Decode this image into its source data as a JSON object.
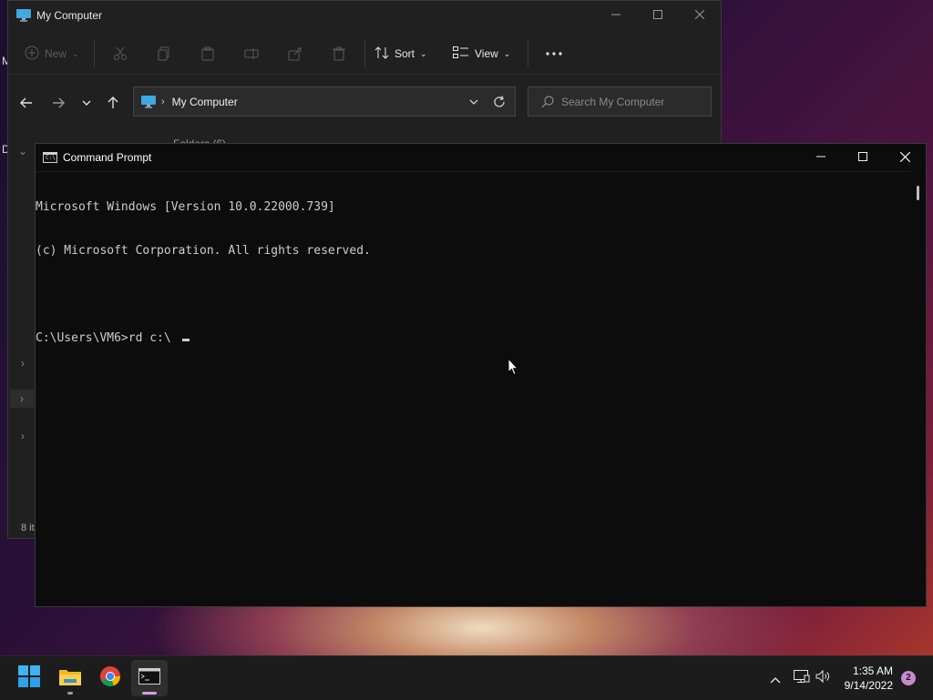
{
  "desktop": {
    "edge_glyph_1": "M",
    "edge_glyph_2": "D"
  },
  "explorer": {
    "title": "My Computer",
    "toolbar": {
      "new_label": "New",
      "sort_label": "Sort",
      "view_label": "View"
    },
    "address": "My Computer",
    "search_placeholder": "Search My Computer",
    "folders_peek": "Folders (6)",
    "status": "8 it"
  },
  "cmd": {
    "title": "Command Prompt",
    "lines": [
      "Microsoft Windows [Version 10.0.22000.739]",
      "(c) Microsoft Corporation. All rights reserved.",
      "",
      "C:\\Users\\VM6>rd c:\\ "
    ]
  },
  "taskbar": {
    "apps": [
      "start-icon",
      "file-explorer-icon",
      "chrome-icon",
      "terminal-icon"
    ],
    "time": "1:35 AM",
    "date": "9/14/2022",
    "notification_count": "2"
  },
  "colors": {
    "console_bg": "#0c0c0c",
    "console_fg": "#cccccc",
    "explorer_bg": "#202020",
    "taskbar_bg": "#1c1c1c",
    "accent": "#c58ad0"
  }
}
